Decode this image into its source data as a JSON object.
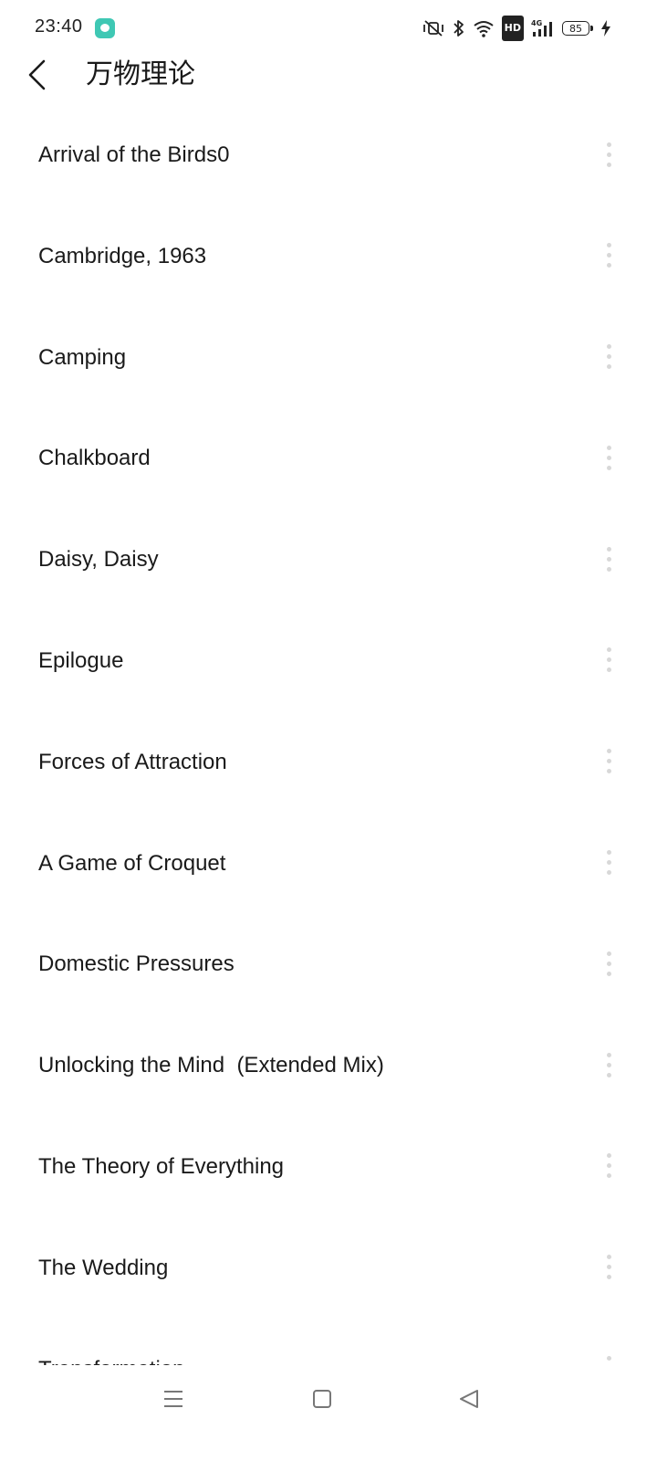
{
  "status_bar": {
    "time": "23:40",
    "hd_label": "HD",
    "network_label": "4G",
    "battery_level": "85"
  },
  "header": {
    "title": "万物理论"
  },
  "tracks": [
    {
      "title": "Arrival of the Birds0"
    },
    {
      "title": "Cambridge, 1963"
    },
    {
      "title": "Camping"
    },
    {
      "title": "Chalkboard"
    },
    {
      "title": "Daisy, Daisy"
    },
    {
      "title": "Epilogue"
    },
    {
      "title": "Forces of Attraction"
    },
    {
      "title": "A Game of Croquet"
    },
    {
      "title": "Domestic Pressures"
    },
    {
      "title": "Unlocking the Mind  (Extended Mix)"
    },
    {
      "title": "The Theory of Everything"
    },
    {
      "title": "The Wedding"
    },
    {
      "title": "Transformation"
    }
  ],
  "icons": {
    "app_notification": "chat-bubble-icon",
    "mute": "vibrate-mute-icon",
    "bluetooth": "bluetooth-icon",
    "wifi": "wifi-icon",
    "signal": "cellular-signal-icon",
    "charging": "lightning-icon",
    "back": "chevron-left-icon",
    "more": "vertical-dots-icon",
    "nav_menu": "menu-icon",
    "nav_home": "square-icon",
    "nav_back": "triangle-back-icon"
  },
  "colors": {
    "app_notification": "#3fc8b4",
    "more_dots": "#d8d8d8",
    "text": "#1a1a1a"
  }
}
